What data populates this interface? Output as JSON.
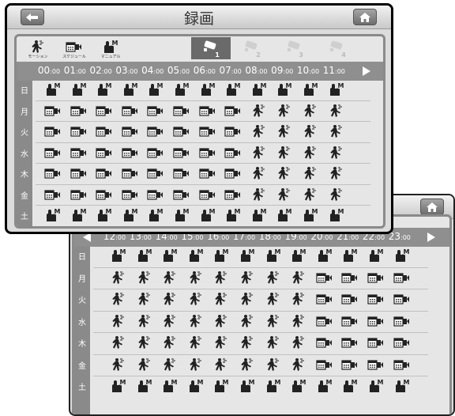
{
  "title": "録画",
  "modes": [
    {
      "label": "モーション",
      "icon": "motion-icon"
    },
    {
      "label": "スケジュール",
      "icon": "schedule-icon"
    },
    {
      "label": "マニュアル",
      "icon": "manual-icon"
    }
  ],
  "cameras": [
    {
      "label": "1",
      "active": true
    },
    {
      "label": "2",
      "active": false
    },
    {
      "label": "3",
      "active": false
    },
    {
      "label": "4",
      "active": false
    }
  ],
  "days": [
    "日",
    "月",
    "火",
    "水",
    "木",
    "金",
    "土"
  ],
  "minutes_label": ":00",
  "screen1": {
    "hours": [
      "00",
      "01",
      "02",
      "03",
      "04",
      "05",
      "06",
      "07",
      "08",
      "09",
      "10",
      "11"
    ],
    "grid": [
      [
        "M",
        "M",
        "M",
        "M",
        "M",
        "M",
        "M",
        "M",
        "M",
        "M",
        "M",
        "M"
      ],
      [
        "S",
        "S",
        "S",
        "S",
        "S",
        "S",
        "S",
        "S",
        "R",
        "R",
        "R",
        "R"
      ],
      [
        "S",
        "S",
        "S",
        "S",
        "S",
        "S",
        "S",
        "S",
        "R",
        "R",
        "R",
        "R"
      ],
      [
        "S",
        "S",
        "S",
        "S",
        "S",
        "S",
        "S",
        "S",
        "R",
        "R",
        "R",
        "R"
      ],
      [
        "S",
        "S",
        "S",
        "S",
        "S",
        "S",
        "S",
        "S",
        "R",
        "R",
        "R",
        "R"
      ],
      [
        "S",
        "S",
        "S",
        "S",
        "S",
        "S",
        "S",
        "S",
        "R",
        "R",
        "R",
        "R"
      ],
      [
        "M",
        "M",
        "M",
        "M",
        "M",
        "M",
        "M",
        "M",
        "M",
        "M",
        "M",
        "M"
      ]
    ]
  },
  "screen2": {
    "hours": [
      "12",
      "13",
      "14",
      "15",
      "16",
      "17",
      "18",
      "19",
      "20",
      "21",
      "22",
      "23"
    ],
    "grid": [
      [
        "M",
        "M",
        "M",
        "M",
        "M",
        "M",
        "M",
        "M",
        "M",
        "M",
        "M",
        "M"
      ],
      [
        "R",
        "R",
        "R",
        "R",
        "R",
        "R",
        "R",
        "R",
        "S",
        "S",
        "S",
        "S"
      ],
      [
        "R",
        "R",
        "R",
        "R",
        "R",
        "R",
        "R",
        "R",
        "S",
        "S",
        "S",
        "S"
      ],
      [
        "R",
        "R",
        "R",
        "R",
        "R",
        "R",
        "R",
        "R",
        "S",
        "S",
        "S",
        "S"
      ],
      [
        "R",
        "R",
        "R",
        "R",
        "R",
        "R",
        "R",
        "R",
        "S",
        "S",
        "S",
        "S"
      ],
      [
        "R",
        "R",
        "R",
        "R",
        "R",
        "R",
        "R",
        "R",
        "S",
        "S",
        "S",
        "S"
      ],
      [
        "M",
        "M",
        "M",
        "M",
        "M",
        "M",
        "M",
        "M",
        "M",
        "M",
        "M",
        "M"
      ]
    ]
  }
}
